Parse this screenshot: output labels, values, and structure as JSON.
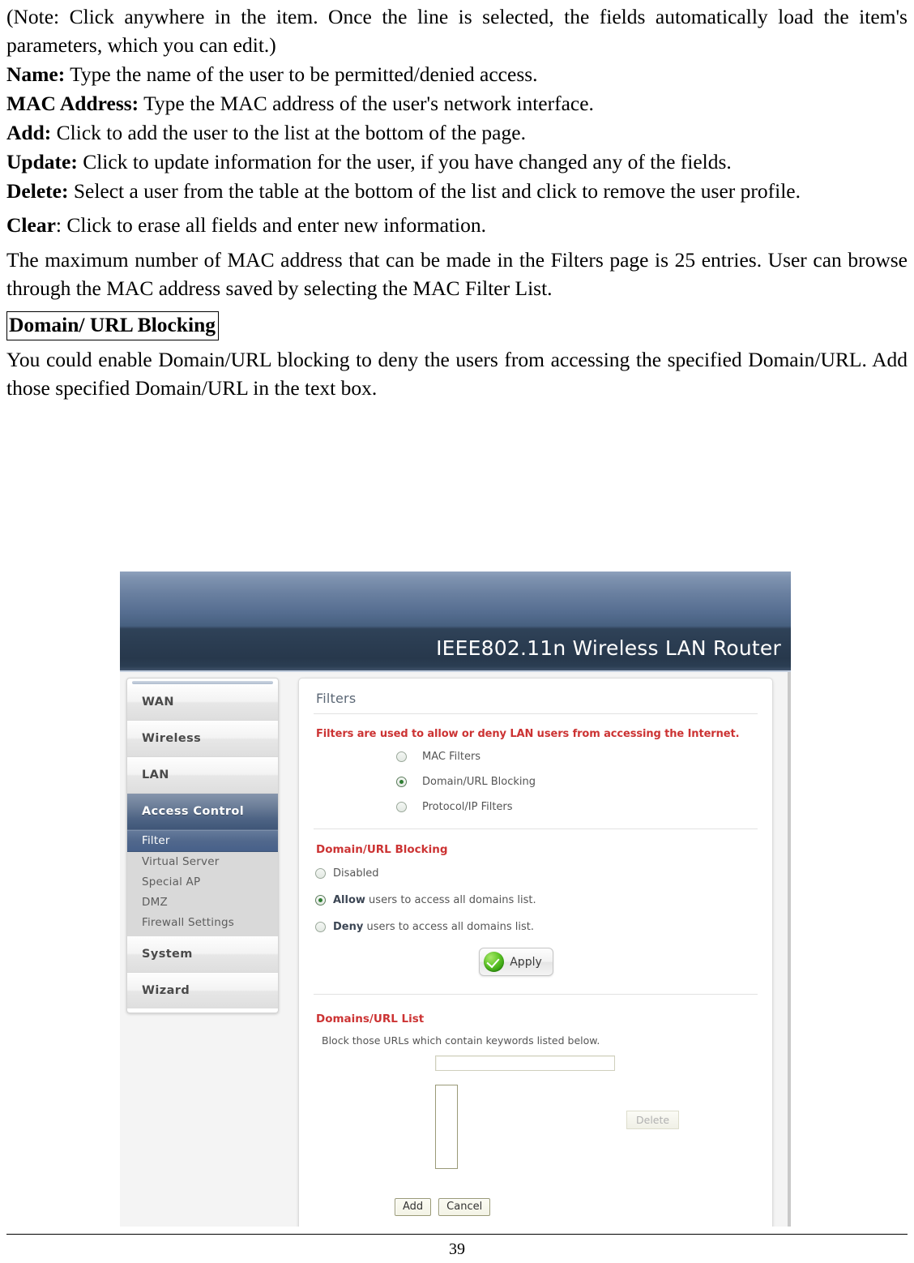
{
  "document": {
    "paragraphs": [
      {
        "id": "note",
        "text": "(Note: Click anywhere in the item. Once the line is selected, the fields automatically load the item's parameters, which you can edit.)"
      },
      {
        "id": "name",
        "bold": "Name:",
        "text": " Type the name of the user to be permitted/denied access."
      },
      {
        "id": "mac-address",
        "bold": "MAC Address:",
        "text": " Type the MAC address of the user's network interface."
      },
      {
        "id": "add",
        "bold": "Add:",
        "text": " Click to add the user to the list at the bottom of the page."
      },
      {
        "id": "update",
        "bold": "Update:",
        "text": " Click to update information for the user, if you have changed any of the fields."
      },
      {
        "id": "delete",
        "bold": "Delete:",
        "text": " Select a user from the table at the bottom of the list and click to remove the user profile."
      },
      {
        "id": "clear",
        "bold": "Clear",
        "text": ": Click to erase all fields and enter new information."
      },
      {
        "id": "max-entries",
        "text": "The maximum number of MAC address that can be made in the Filters page is 25 entries. User can browse through the MAC address saved by selecting the MAC Filter List."
      }
    ],
    "section_heading": "Domain/ URL Blocking",
    "section_body": "You could enable Domain/URL blocking to deny the users from accessing the specified Domain/URL.  Add those specified Domain/URL in the text box.",
    "page_number": "39"
  },
  "router_ui": {
    "header": {
      "title": "IEEE802.11n  Wireless LAN Router"
    },
    "sidebar": {
      "items": [
        {
          "label": "WAN",
          "active": false
        },
        {
          "label": "Wireless",
          "active": false
        },
        {
          "label": "LAN",
          "active": false
        },
        {
          "label": "Access Control",
          "active": true
        }
      ],
      "sub_items": [
        {
          "label": "Filter",
          "selected": true
        },
        {
          "label": "Virtual Server",
          "selected": false
        },
        {
          "label": "Special AP",
          "selected": false
        },
        {
          "label": "DMZ",
          "selected": false
        },
        {
          "label": "Firewall Settings",
          "selected": false
        }
      ],
      "trailing_items": [
        {
          "label": "System",
          "active": false
        },
        {
          "label": "Wizard",
          "active": false
        }
      ]
    },
    "panel": {
      "title": "Filters",
      "lead": "Filters are used to allow or deny LAN users from accessing the Internet.",
      "filter_modes": [
        {
          "label": "MAC Filters",
          "selected": false
        },
        {
          "label": "Domain/URL Blocking",
          "selected": true
        },
        {
          "label": "Protocol/IP Filters",
          "selected": false
        }
      ],
      "blocking": {
        "heading": "Domain/URL Blocking",
        "options": [
          {
            "strong": "",
            "label": "Disabled",
            "selected": false
          },
          {
            "strong": "Allow",
            "label": " users to access all domains list.",
            "selected": true
          },
          {
            "strong": "Deny",
            "label": " users to access all domains list.",
            "selected": false
          }
        ],
        "apply_label": "Apply"
      },
      "domains_list": {
        "heading": "Domains/URL List",
        "hint": "Block those URLs which contain keywords listed below.",
        "keyword_value": "",
        "keyword_placeholder": "",
        "list_items": [],
        "delete_label": "Delete",
        "add_label": "Add",
        "cancel_label": "Cancel"
      }
    },
    "colors": {
      "accent_red": "#cc3333",
      "header_navy": "#27384c",
      "active_nav": "#4e6485",
      "apply_green": "#2f9c0c"
    }
  }
}
